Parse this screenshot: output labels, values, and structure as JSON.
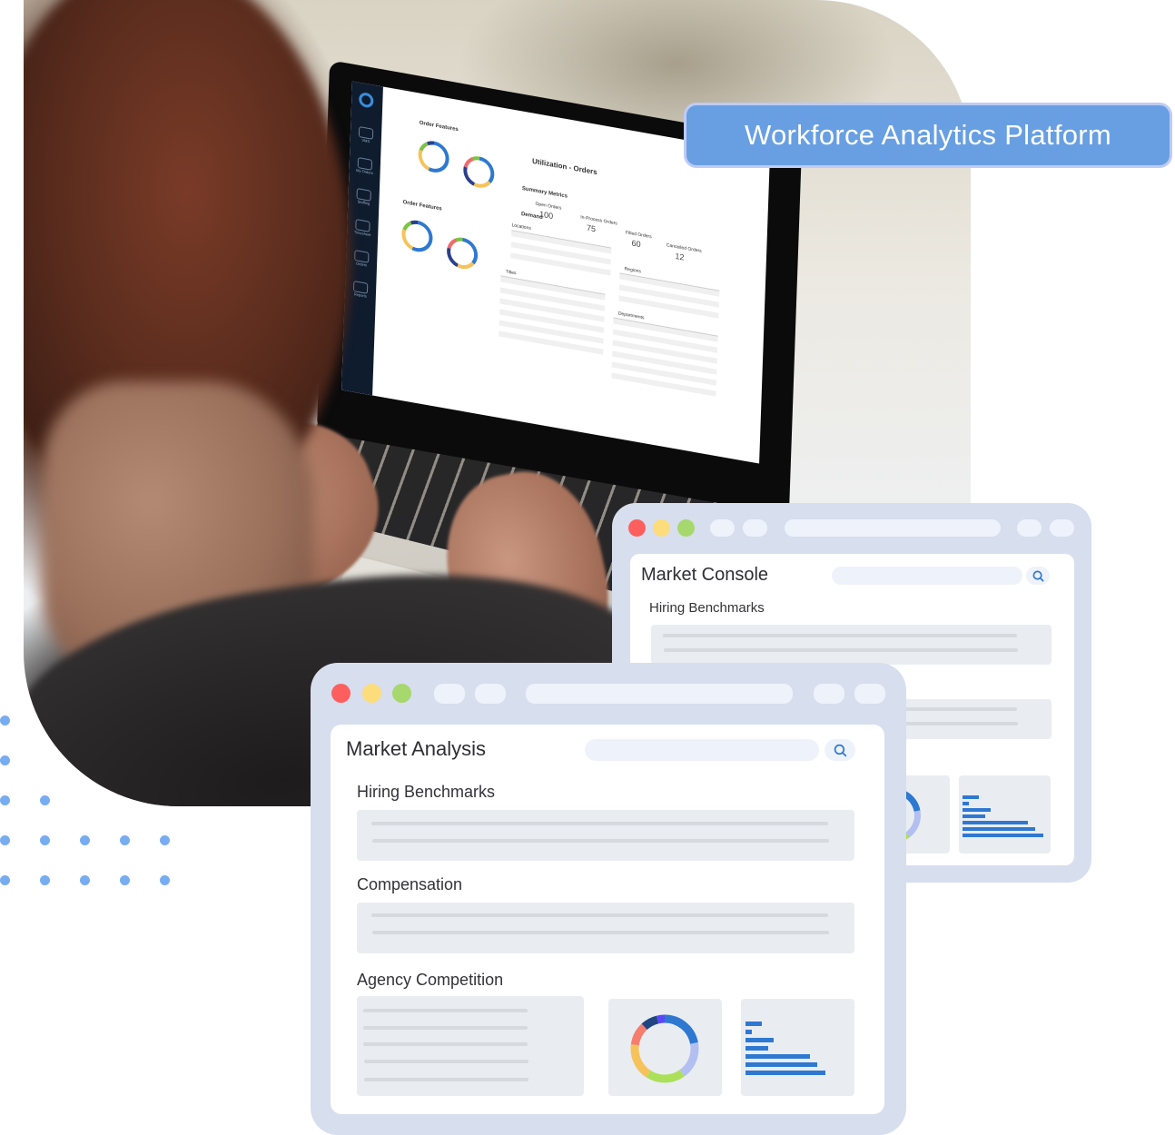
{
  "banner": {
    "title": "Workforce Analytics Platform"
  },
  "laptop_screen": {
    "page_title": "Utilization - Orders",
    "sidebar_items": [
      {
        "label": "VMS",
        "icon": "broadcast-icon"
      },
      {
        "label": "My Orders",
        "icon": "cart-icon"
      },
      {
        "label": "Staffing",
        "icon": "user-icon"
      },
      {
        "label": "Timesheet",
        "icon": "stopwatch-icon"
      },
      {
        "label": "Orders",
        "icon": "basket-icon"
      },
      {
        "label": "Reports",
        "icon": "bar-chart-icon"
      }
    ],
    "panels": [
      {
        "heading": "Order Features"
      },
      {
        "heading": "Order Features"
      }
    ],
    "summary_heading": "Summary Metrics",
    "demand_heading": "Demand",
    "metrics": [
      {
        "label": "Open Orders",
        "value": "100"
      },
      {
        "label": "In-Process Orders",
        "value": "75"
      },
      {
        "label": "Filled Orders",
        "value": "60"
      },
      {
        "label": "Cancelled Orders",
        "value": "12"
      }
    ],
    "tables": [
      {
        "heading": "Locations"
      },
      {
        "heading": "Regions"
      },
      {
        "heading": "Titles"
      },
      {
        "heading": "Departments"
      }
    ],
    "donut_colors": [
      "#2e78d2",
      "#f6c25a",
      "#7cc444",
      "#2b3f8c",
      "#ef6c6c"
    ]
  },
  "windows": {
    "console": {
      "title": "Market Console",
      "sections": [
        "Hiring Benchmarks"
      ],
      "traffic_lights": [
        "#fd5f5f",
        "#fddc7b",
        "#a6d86d"
      ]
    },
    "analysis": {
      "title": "Market Analysis",
      "sections": [
        "Hiring Benchmarks",
        "Compensation",
        "Agency Competition"
      ],
      "traffic_lights": [
        "#fd5f5f",
        "#fddc7b",
        "#a6d86d"
      ]
    }
  },
  "agency_donut": {
    "segments": [
      {
        "color": "#2e78d2",
        "share": 0.22
      },
      {
        "color": "#b2bff0",
        "share": 0.18
      },
      {
        "color": "#acdf5a",
        "share": 0.19
      },
      {
        "color": "#f6c25a",
        "share": 0.18
      },
      {
        "color": "#f67c6c",
        "share": 0.11
      },
      {
        "color": "#1f4682",
        "share": 0.08
      },
      {
        "color": "#5a47f8",
        "share": 0.04
      }
    ]
  },
  "agency_bars": {
    "values": [
      0.2,
      0.08,
      0.35,
      0.28,
      0.81,
      0.9,
      1.0
    ],
    "color": "#2e78d2"
  }
}
